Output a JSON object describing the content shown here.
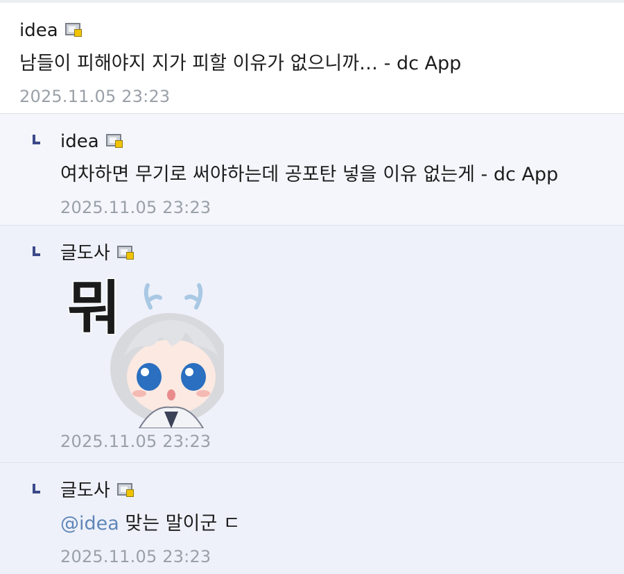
{
  "comments": [
    {
      "nick": "idea",
      "text": "남들이 피해야지 지가 피할 이유가 없으니까… - dc App",
      "time": "2025.11.05 23:23"
    },
    {
      "nick": "idea",
      "text": "여차하면 무기로 써야하는데 공포탄 넣을 이유 없는게 - dc App",
      "time": "2025.11.05 23:23"
    },
    {
      "nick": "글도사",
      "sticker_text": "뭐",
      "time": "2025.11.05 23:23"
    },
    {
      "nick": "글도사",
      "mention": "@idea",
      "text": "맞는 말이군 ㄷ",
      "time": "2025.11.05 23:23"
    }
  ],
  "icons": {
    "reply_mark": "reply-arrow-icon",
    "member_badge": "fixed-nick-badge-icon"
  },
  "colors": {
    "reply_bg": "#f4f6fb",
    "mention": "#5f86b7",
    "timestamp": "#9aa0a8",
    "reply_mark": "#3c4a8a"
  }
}
